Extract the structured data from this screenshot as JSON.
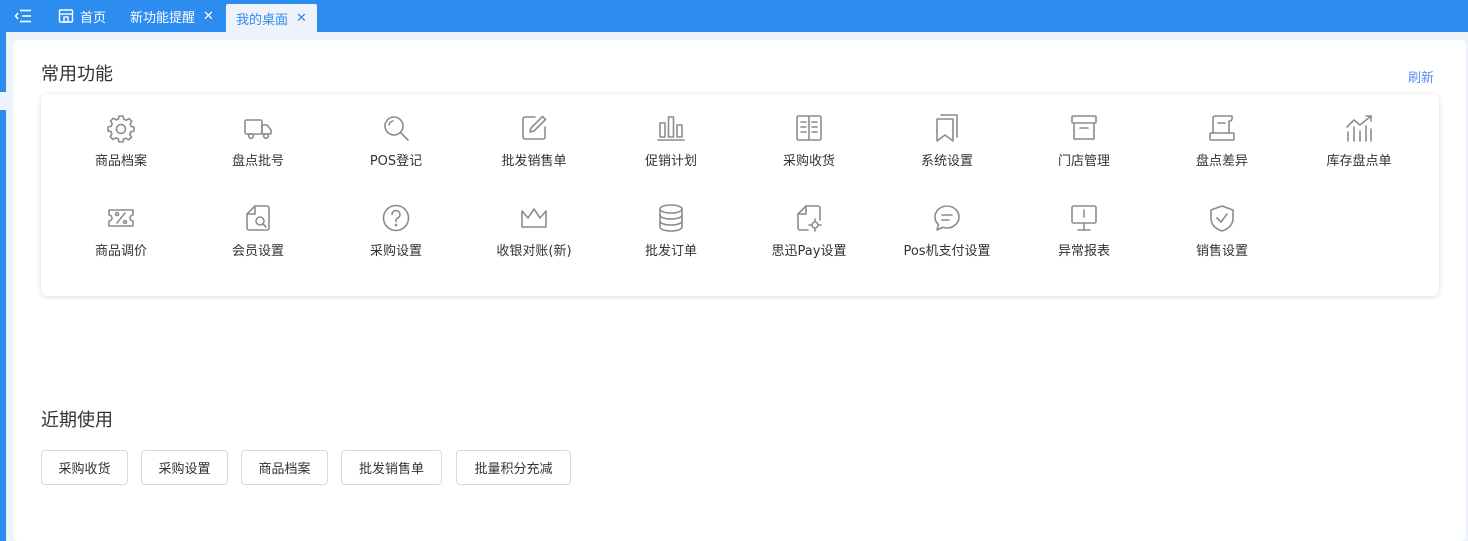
{
  "tabs": [
    {
      "label": "首页",
      "icon": "home-icon"
    },
    {
      "label": "新功能提醒",
      "close": "✕"
    },
    {
      "label": "我的桌面",
      "close": "✕",
      "active": true
    }
  ],
  "common": {
    "title": "常用功能",
    "refresh": "刷新",
    "items": [
      {
        "label": "商品档案",
        "icon": "gear-icon"
      },
      {
        "label": "盘点批号",
        "icon": "truck-icon"
      },
      {
        "label": "POS登记",
        "icon": "search-icon"
      },
      {
        "label": "批发销售单",
        "icon": "edit-icon"
      },
      {
        "label": "促销计划",
        "icon": "bar-chart-icon"
      },
      {
        "label": "采购收货",
        "icon": "book-icon"
      },
      {
        "label": "系统设置",
        "icon": "bookmark-icon"
      },
      {
        "label": "门店管理",
        "icon": "archive-box-icon"
      },
      {
        "label": "盘点差异",
        "icon": "scroll-icon"
      },
      {
        "label": "库存盘点单",
        "icon": "trend-chart-icon"
      },
      {
        "label": "商品调价",
        "icon": "discount-ticket-icon"
      },
      {
        "label": "会员设置",
        "icon": "file-search-icon"
      },
      {
        "label": "采购设置",
        "icon": "question-circle-icon"
      },
      {
        "label": "收银对账(新)",
        "icon": "crown-icon"
      },
      {
        "label": "批发订单",
        "icon": "database-icon"
      },
      {
        "label": "思迅Pay设置",
        "icon": "file-settings-icon"
      },
      {
        "label": "Pos机支付设置",
        "icon": "chat-bubble-icon"
      },
      {
        "label": "异常报表",
        "icon": "monitor-icon"
      },
      {
        "label": "销售设置",
        "icon": "shield-check-icon"
      }
    ]
  },
  "recent": {
    "title": "近期使用",
    "items": [
      "采购收货",
      "采购设置",
      "商品档案",
      "批发销售单",
      "批量积分充减"
    ]
  },
  "colors": {
    "accent": "#2d8cf0",
    "icon_gray": "#8c8c8c",
    "link": "#5b8def"
  }
}
